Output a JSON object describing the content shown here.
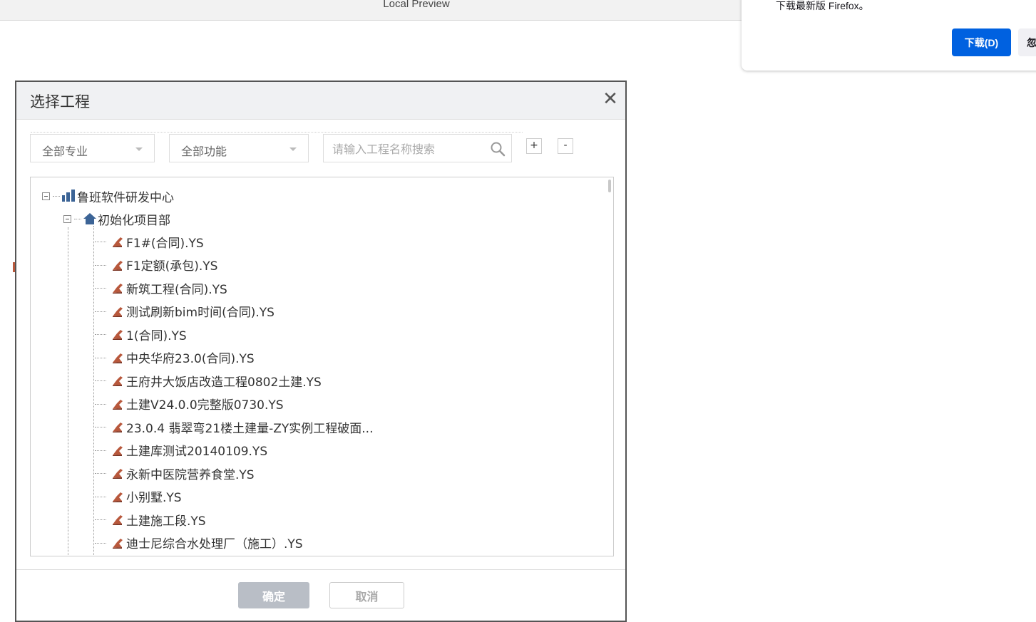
{
  "topbar": {
    "title": "Local Preview"
  },
  "notification": {
    "message": "下载最新版 Firefox。",
    "download_label": "下载(D)",
    "ignore_label": "忽"
  },
  "dialog": {
    "title": "选择工程",
    "filters": {
      "specialty": "全部专业",
      "function": "全部功能",
      "search_placeholder": "请输入工程名称搜索",
      "expand_label": "+",
      "collapse_label": "-"
    },
    "tree": {
      "root": "鲁班软件研发中心",
      "department": "初始化项目部",
      "projects": [
        "F1#(合同).YS",
        "F1定额(承包).YS",
        "新筑工程(合同).YS",
        "测试刷新bim时间(合同).YS",
        "1(合同).YS",
        "中央华府23.0(合同).YS",
        "王府井大饭店改造工程0802土建.YS",
        "土建V24.0.0完整版0730.YS",
        "23.0.4 翡翠弯21楼土建量-ZY实例工程破面...",
        "土建库测试20140109.YS",
        "永新中医院营养食堂.YS",
        "小别墅.YS",
        "土建施工段.YS",
        "迪士尼综合水处理厂（施工）.YS"
      ]
    },
    "ok_label": "确定",
    "cancel_label": "取消"
  },
  "colors": {
    "primary_blue": "#0061e0",
    "disabled_button": "#b9bec6",
    "header_bg": "#f0f1f3",
    "root_icon": "#3c6496",
    "file_icon": "#b8583c"
  }
}
